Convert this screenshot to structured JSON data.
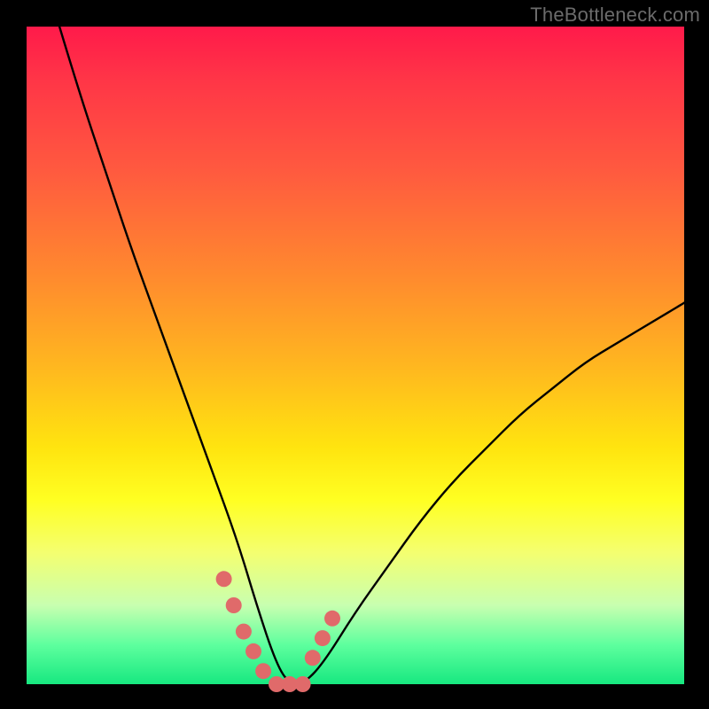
{
  "watermark": "TheBottleneck.com",
  "colors": {
    "frame": "#000000",
    "gradient_top": "#ff1a4a",
    "gradient_mid1": "#ff8a2e",
    "gradient_mid2": "#ffe40f",
    "gradient_bottom": "#17e880",
    "curve": "#000000",
    "marker": "#e06a6a"
  },
  "chart_data": {
    "type": "line",
    "title": "",
    "xlabel": "",
    "ylabel": "",
    "xlim": [
      0,
      100
    ],
    "ylim": [
      0,
      100
    ],
    "note": "Bottleneck-style V-curve; minimum (~0%) around x≈36–42; left branch rises to ~100% at x≈5; right branch rises to ~58% at x=100.",
    "series": [
      {
        "name": "bottleneck-curve",
        "x": [
          5,
          8,
          12,
          16,
          20,
          24,
          28,
          32,
          35,
          38,
          40,
          42,
          45,
          50,
          55,
          60,
          65,
          70,
          75,
          80,
          85,
          90,
          95,
          100
        ],
        "y": [
          100,
          90,
          78,
          66,
          55,
          44,
          33,
          22,
          12,
          3,
          0,
          0,
          3,
          11,
          18,
          25,
          31,
          36,
          41,
          45,
          49,
          52,
          55,
          58
        ]
      }
    ],
    "markers": {
      "name": "highlighted-points",
      "color": "#e06a6a",
      "x": [
        30,
        31.5,
        33,
        34.5,
        36,
        38,
        40,
        42,
        43.5,
        45,
        46.5
      ],
      "y": [
        16,
        12,
        8,
        5,
        2,
        0,
        0,
        0,
        4,
        7,
        10
      ]
    }
  }
}
